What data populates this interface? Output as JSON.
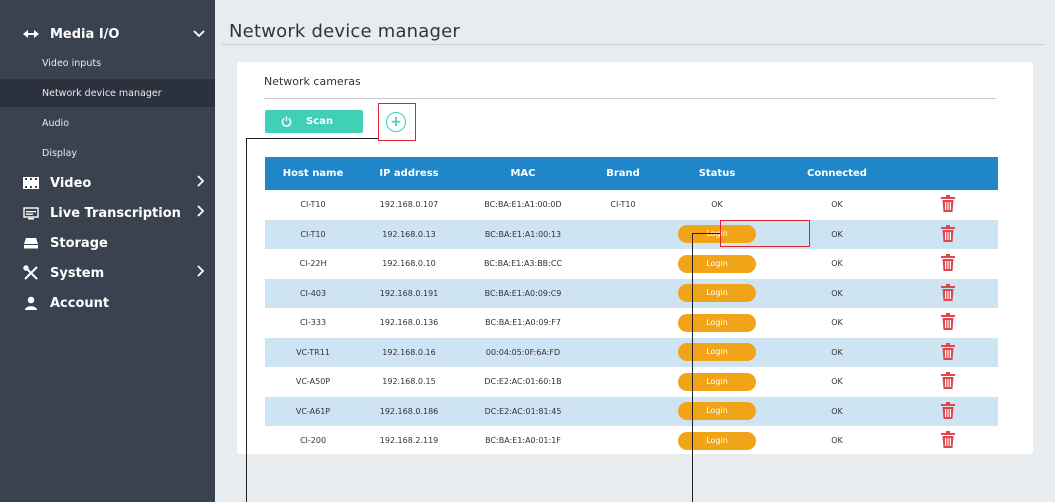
{
  "sidebar": {
    "media_io": {
      "label": "Media I/O",
      "icon": "media-io-icon"
    },
    "sub_items": [
      {
        "label": "Video inputs"
      },
      {
        "label": "Network device manager",
        "active": true
      },
      {
        "label": "Audio"
      },
      {
        "label": "Display"
      }
    ],
    "video": {
      "label": "Video",
      "icon": "film-icon"
    },
    "live_transcription": {
      "label": "Live Transcription",
      "icon": "transcription-icon"
    },
    "storage": {
      "label": "Storage",
      "icon": "storage-icon"
    },
    "system": {
      "label": "System",
      "icon": "tools-icon"
    },
    "account": {
      "label": "Account",
      "icon": "user-icon"
    }
  },
  "page": {
    "title": "Network device manager",
    "panel_title": "Network cameras",
    "scan_label": "Scan",
    "add_symbol": "+"
  },
  "table": {
    "headers": {
      "host": "Host name",
      "ip": "IP address",
      "mac": "MAC",
      "brand": "Brand",
      "status": "Status",
      "connected": "Connected"
    },
    "rows": [
      {
        "host": "CI-T10",
        "ip": "192.168.0.107",
        "mac": "BC:BA:E1:A1:00:0D",
        "brand": "CI-T10",
        "status": "OK",
        "connected": "OK"
      },
      {
        "host": "CI-T10",
        "ip": "192.168.0.13",
        "mac": "BC:BA:E1:A1:00:13",
        "brand": "",
        "status": "Login",
        "connected": "OK"
      },
      {
        "host": "CI-22H",
        "ip": "192.168.0.10",
        "mac": "BC:BA:E1:A3:BB:CC",
        "brand": "",
        "status": "Login",
        "connected": "OK"
      },
      {
        "host": "CI-403",
        "ip": "192.168.0.191",
        "mac": "BC:BA:E1:A0:09:C9",
        "brand": "",
        "status": "Login",
        "connected": "OK"
      },
      {
        "host": "CI-333",
        "ip": "192.168.0.136",
        "mac": "BC:BA:E1:A0:09:F7",
        "brand": "",
        "status": "Login",
        "connected": "OK"
      },
      {
        "host": "VC-TR11",
        "ip": "192.168.0.16",
        "mac": "00:04:05:0F:6A:FD",
        "brand": "",
        "status": "Login",
        "connected": "OK"
      },
      {
        "host": "VC-A50P",
        "ip": "192.168.0.15",
        "mac": "DC:E2:AC:01:60:1B",
        "brand": "",
        "status": "Login",
        "connected": "OK"
      },
      {
        "host": "VC-A61P",
        "ip": "192.168.0.186",
        "mac": "DC:E2:AC:01:81:45",
        "brand": "",
        "status": "Login",
        "connected": "OK"
      },
      {
        "host": "CI-200",
        "ip": "192.168.2.119",
        "mac": "BC:BA:E1:A0:01:1F",
        "brand": "",
        "status": "Login",
        "connected": "OK"
      }
    ]
  },
  "colors": {
    "sidebar_bg": "#3a4250",
    "header_blue": "#1e86c9",
    "row_alt": "#cfe4f2",
    "scan_green": "#3fd0b5",
    "login_orange": "#f2a419",
    "delete_red": "#e0474c",
    "highlight_red": "#d9262e"
  }
}
